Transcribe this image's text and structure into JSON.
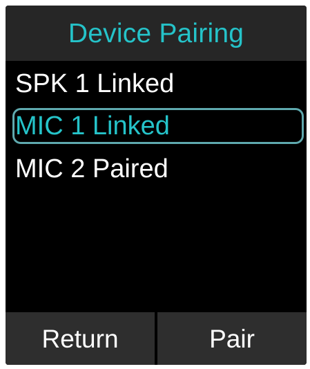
{
  "header": {
    "title": "Device Pairing"
  },
  "devices": [
    {
      "label": "SPK 1 Linked",
      "selected": false
    },
    {
      "label": "MIC 1 Linked",
      "selected": true
    },
    {
      "label": "MIC 2 Paired",
      "selected": false
    }
  ],
  "softkeys": {
    "left_label": "Return",
    "right_label": "Pair"
  },
  "colors": {
    "accent": "#25c3c9",
    "selection_border": "#5fa9ae",
    "background": "#000000",
    "title_bar": "#262626",
    "softkey_bg": "#2e2e2e",
    "text": "#ffffff"
  }
}
